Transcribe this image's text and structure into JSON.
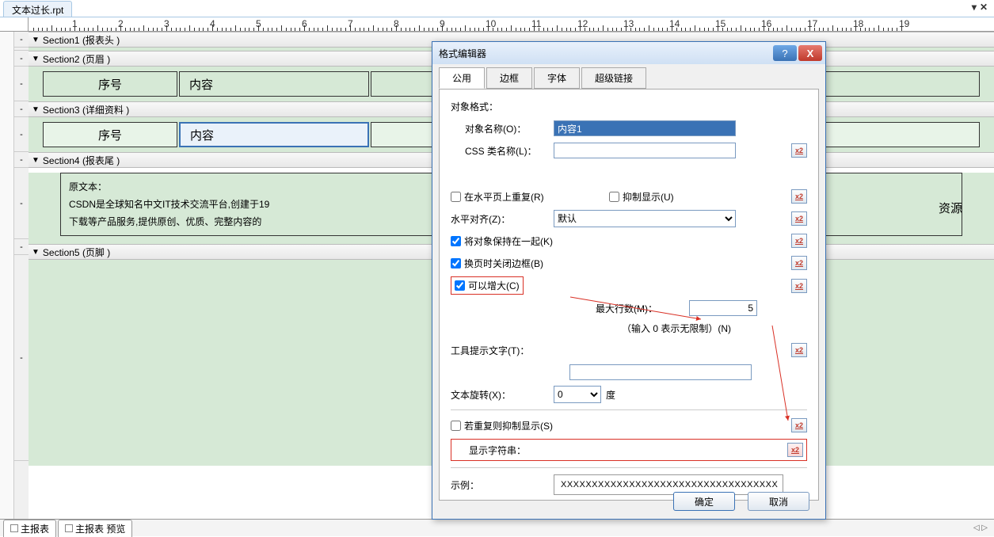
{
  "file_tab": "文本过长.rpt",
  "ruler_numbers": [
    "1",
    "2",
    "3",
    "4",
    "5",
    "6",
    "7",
    "8",
    "9",
    "10",
    "11",
    "12",
    "13",
    "14",
    "15",
    "16",
    "17",
    "18",
    "19"
  ],
  "sections": {
    "s1": "Section1 (报表头 )",
    "s2": "Section2 (页眉 )",
    "s3": "Section3 (详细资料 )",
    "s4": "Section4 (报表尾 )",
    "s5": "Section5 (页脚 )"
  },
  "header_row": {
    "col1": "序号",
    "col2": "内容"
  },
  "detail_row": {
    "col1": "序号",
    "col2": "内容"
  },
  "longtext_line1": "原文本：",
  "longtext_line2": "CSDN是全球知名中文IT技术交流平台,创建于19",
  "longtext_line3": "下载等产品服务,提供原创、优质、完整内容的",
  "longtext_frag_right": "资源",
  "bottom_tab1": "主报表",
  "bottom_tab2": "主报表 预览",
  "dialog": {
    "title": "格式编辑器",
    "tabs": [
      "公用",
      "边框",
      "字体",
      "超级链接"
    ],
    "obj_format": "对象格式：",
    "obj_name_lbl": "对象名称(O)：",
    "obj_name_val": "内容1",
    "css_name_lbl": "CSS 类名称(L)：",
    "css_name_val": "",
    "repeat_h": "在水平页上重复(R)",
    "suppress": "抑制显示(U)",
    "halign_lbl": "水平对齐(Z)：",
    "halign_val": "默认",
    "keep_together": "将对象保持在一起(K)",
    "close_border": "换页时关闭边框(B)",
    "can_grow": "可以增大(C)",
    "max_rows_lbl": "最大行数(M)：",
    "max_rows_val": "5",
    "max_rows_hint": "（输入 0 表示无限制）(N)",
    "tooltip_lbl": "工具提示文字(T)：",
    "tooltip_val": "",
    "rotate_lbl": "文本旋转(X)：",
    "rotate_val": "0",
    "rotate_unit": "度",
    "suppress_dup": "若重复则抑制显示(S)",
    "show_str": "显示字符串：",
    "sample_lbl": "示例：",
    "sample_val": "XXXXXXXXXXXXXXXXXXXXXXXXXXXXXXXXXXX",
    "ok": "确定",
    "cancel": "取消"
  }
}
